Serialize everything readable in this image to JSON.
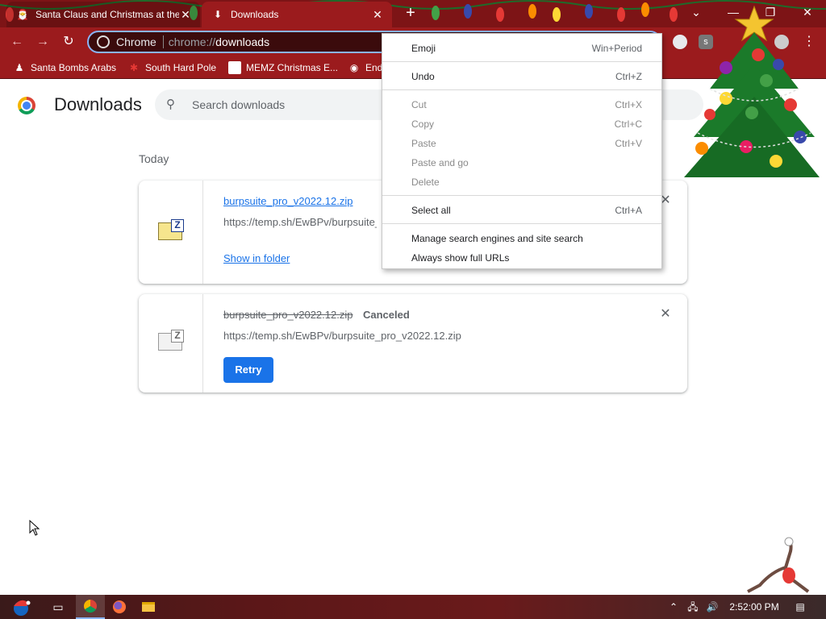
{
  "browser": {
    "tabs": [
      {
        "title": "Santa Claus and Christmas at the",
        "icon": "santa-favicon",
        "active": false
      },
      {
        "title": "Downloads",
        "icon": "download-icon",
        "active": true
      }
    ],
    "omnibox": {
      "chip_label": "Chrome",
      "url_scheme": "chrome://",
      "url_path": "downloads"
    },
    "bookmarks": [
      {
        "label": "Santa Bombs Arabs",
        "icon": "santa-figure-icon"
      },
      {
        "label": "South Hard Pole",
        "icon": "snowflake-icon"
      },
      {
        "label": "MEMZ Christmas E...",
        "icon": "memz-icon"
      },
      {
        "label": "End",
        "icon": "cat-icon"
      }
    ]
  },
  "downloads_page": {
    "title": "Downloads",
    "search_placeholder": "Search downloads",
    "date_heading": "Today",
    "items": [
      {
        "file_name": "burpsuite_pro_v2022.12.zip",
        "url": "https://temp.sh/EwBPv/burpsuite_",
        "action_label": "Show in folder",
        "state": "complete"
      },
      {
        "file_name": "burpsuite_pro_v2022.12.zip",
        "status": "Canceled",
        "url": "https://temp.sh/EwBPv/burpsuite_pro_v2022.12.zip",
        "action_label": "Retry",
        "state": "canceled"
      }
    ]
  },
  "context_menu": {
    "items": [
      {
        "label": "Emoji",
        "shortcut": "Win+Period",
        "enabled": true
      },
      {
        "label": "Undo",
        "shortcut": "Ctrl+Z",
        "enabled": true
      },
      {
        "label": "Cut",
        "shortcut": "Ctrl+X",
        "enabled": false
      },
      {
        "label": "Copy",
        "shortcut": "Ctrl+C",
        "enabled": false
      },
      {
        "label": "Paste",
        "shortcut": "Ctrl+V",
        "enabled": false
      },
      {
        "label": "Paste and go",
        "shortcut": "",
        "enabled": false
      },
      {
        "label": "Delete",
        "shortcut": "",
        "enabled": false
      },
      {
        "label": "Select all",
        "shortcut": "Ctrl+A",
        "enabled": true
      },
      {
        "label": "Manage search engines and site search",
        "shortcut": "",
        "enabled": true
      },
      {
        "label": "Always show full URLs",
        "shortcut": "",
        "enabled": true
      }
    ]
  },
  "taskbar": {
    "clock": "2:52:00 PM"
  },
  "colors": {
    "accent": "#1a73e8",
    "titlebar": "#7d1416",
    "toolbar": "#9b1b1d"
  }
}
